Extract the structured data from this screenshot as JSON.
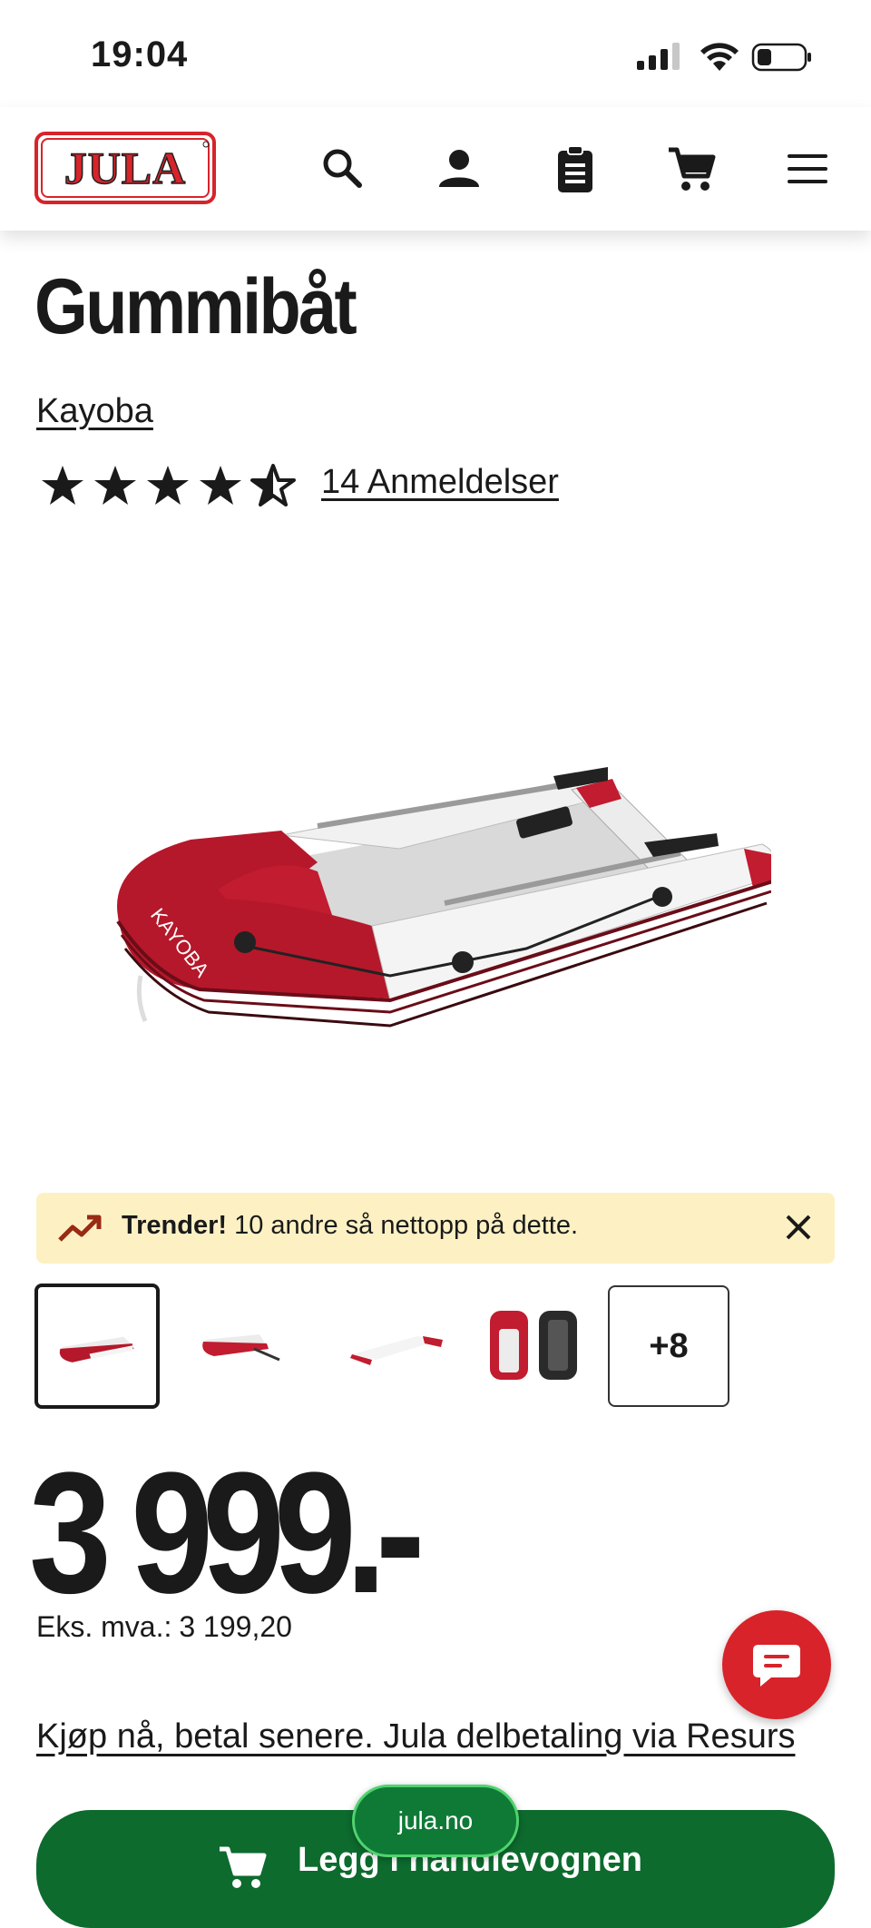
{
  "status_bar": {
    "time": "19:04",
    "icons": [
      "signal-icon",
      "wifi-icon",
      "battery-icon"
    ]
  },
  "header": {
    "logo_text": "JULA",
    "icons": [
      "search-icon",
      "account-icon",
      "clipboard-icon",
      "cart-icon",
      "menu-icon"
    ]
  },
  "product": {
    "title": "Gummibåt",
    "brand": "Kayoba",
    "rating": 4.5,
    "rating_max": 5,
    "reviews_label": "14 Anmeldelser"
  },
  "trending": {
    "bold": "Trender!",
    "text": "10 andre så nettopp på dette."
  },
  "gallery": {
    "selected_index": 0,
    "more_label": "+8"
  },
  "price": {
    "amount": "3 999.-",
    "vat_label": "Eks. mva.:",
    "vat_value": "3 199,20"
  },
  "payment_link": "Kjøp nå, betal senere. Jula delbetaling via Resurs",
  "cart_button": {
    "label": "Legg i handlevognen"
  },
  "browser": {
    "url": "jula.no"
  },
  "colors": {
    "brand_red": "#d8232a",
    "cart_green": "#0d6b2e",
    "trend_bg": "#fdf1c4"
  }
}
